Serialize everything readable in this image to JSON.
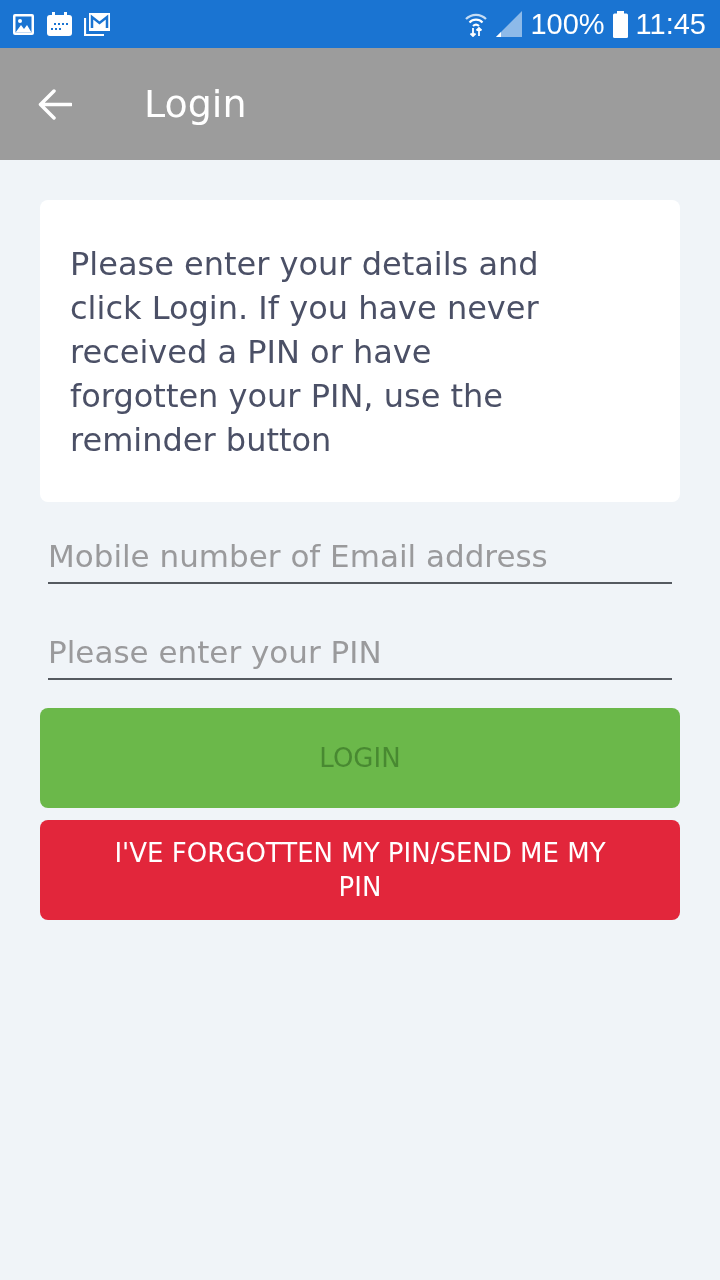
{
  "status_bar": {
    "battery": "100%",
    "time": "11:45"
  },
  "app_bar": {
    "title": "Login"
  },
  "info_card": {
    "text": "Please enter your details and click Login. If you have never received a PIN or have forgotten your PIN, use the reminder button"
  },
  "fields": [
    {
      "placeholder": "Mobile number of Email address"
    },
    {
      "placeholder": "Please enter your PIN"
    }
  ],
  "buttons": [
    {
      "label": "LOGIN",
      "kind": "primary",
      "disabled": true
    },
    {
      "label": "I'VE FORGOTTEN MY PIN/SEND ME MY PIN",
      "kind": "danger",
      "disabled": false
    }
  ]
}
